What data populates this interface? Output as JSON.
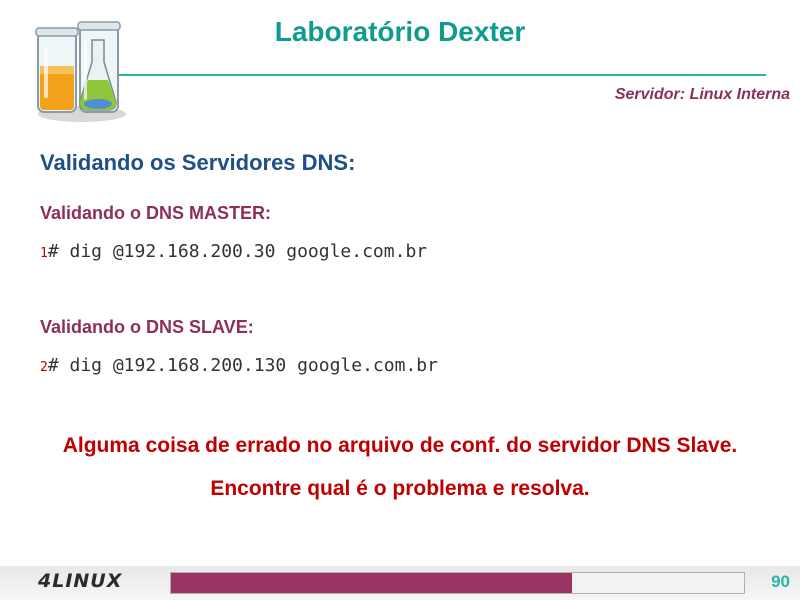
{
  "header": {
    "title": "Laboratório Dexter",
    "subtitle": "Servidor: Linux Interna"
  },
  "content": {
    "section_title": "Validando os Servidores DNS:",
    "master_label": "Validando o DNS MASTER:",
    "master_cmd_num": "1",
    "master_cmd": "# dig @192.168.200.30 google.com.br",
    "slave_label": "Validando o DNS SLAVE:",
    "slave_cmd_num": "2",
    "slave_cmd": "# dig @192.168.200.130 google.com.br",
    "warning_line1": "Alguma coisa de errado no arquivo de conf. do servidor DNS Slave.",
    "warning_line2": "Encontre qual é o problema e resolva."
  },
  "footer": {
    "brand": "4LINUX",
    "page_number": "90",
    "progress_fraction": 0.7
  },
  "colors": {
    "title": "#119b8f",
    "accent": "#9b3463",
    "warning": "#c00000"
  }
}
